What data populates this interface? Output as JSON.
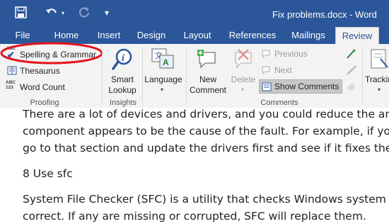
{
  "titlebar": {
    "title": "Fix problems.docx - Word"
  },
  "tabs": [
    {
      "label": "File"
    },
    {
      "label": "Home"
    },
    {
      "label": "Insert"
    },
    {
      "label": "Design"
    },
    {
      "label": "Layout"
    },
    {
      "label": "References"
    },
    {
      "label": "Mailings"
    },
    {
      "label": "Review"
    }
  ],
  "active_tab": "Review",
  "ribbon": {
    "proofing": {
      "label": "Proofing",
      "spelling": "Spelling & Grammar",
      "thesaurus": "Thesaurus",
      "word_count": "Word Count",
      "word_count_icon_text": "ABC\n123"
    },
    "insights": {
      "label": "Insights",
      "smart_lookup_line1": "Smart",
      "smart_lookup_line2": "Lookup"
    },
    "language": {
      "label": "Language"
    },
    "comments": {
      "label": "Comments",
      "new_line1": "New",
      "new_line2": "Comment",
      "delete": "Delete",
      "previous": "Previous",
      "next": "Next",
      "show_comments": "Show Comments"
    },
    "tracking": {
      "label": "Tracking"
    }
  },
  "document": {
    "lines": [
      "There are a lot of devices and drivers, and you could reduce the amount",
      "component appears to be the cause of the fault. For example, if you are l",
      "go to that section and update the drivers first and see if it fixes the proble",
      "8 Use sfc",
      "System File Checker (SFC) is a utility that checks Windows system files an",
      "correct. If any are missing or corrupted, SFC will replace them."
    ]
  },
  "colors": {
    "brand_blue": "#2b579a",
    "highlight_red": "#e3141b"
  }
}
